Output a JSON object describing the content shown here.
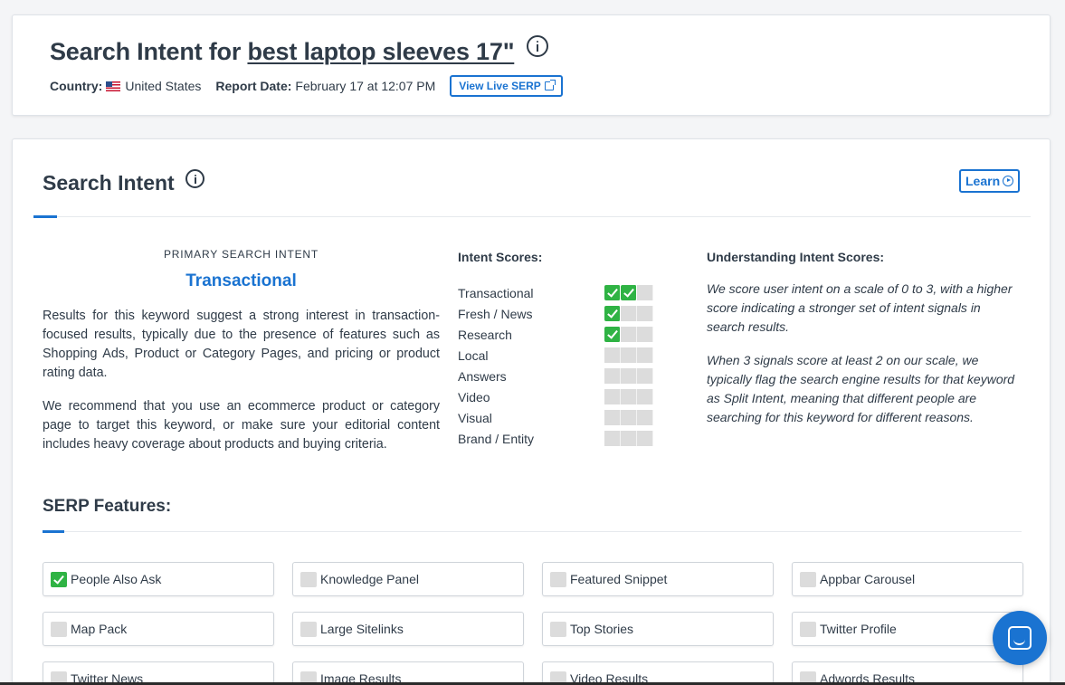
{
  "header": {
    "title_prefix": "Search Intent for",
    "keyword": "best laptop sleeves 17\"",
    "country_label": "Country:",
    "country_value": "United States",
    "report_date_label": "Report Date:",
    "report_date_value": "February 17 at 12:07 PM",
    "view_live_serp": "View Live SERP"
  },
  "intent_section": {
    "title": "Search Intent",
    "learn_label": "Learn",
    "primary_label": "PRIMARY SEARCH INTENT",
    "primary_value": "Transactional",
    "paragraph1": "Results for this keyword suggest a strong interest in transaction-focused results, typically due to the presence of features such as Shopping Ads, Product or Category Pages, and pricing or product rating data.",
    "paragraph2": "We recommend that you use an ecommerce product or category page to target this keyword, or make sure your editorial content includes heavy coverage about products and buying criteria.",
    "scores_title": "Intent Scores:",
    "scores": [
      {
        "name": "Transactional",
        "score": 2
      },
      {
        "name": "Fresh / News",
        "score": 1
      },
      {
        "name": "Research",
        "score": 1
      },
      {
        "name": "Local",
        "score": 0
      },
      {
        "name": "Answers",
        "score": 0
      },
      {
        "name": "Video",
        "score": 0
      },
      {
        "name": "Visual",
        "score": 0
      },
      {
        "name": "Brand / Entity",
        "score": 0
      }
    ],
    "understanding_title": "Understanding Intent Scores:",
    "understanding_p1": "We score user intent on a scale of 0 to 3, with a higher score indicating a stronger set of intent signals in search results.",
    "understanding_p2": "When 3 signals score at least 2 on our scale, we typically flag the search engine results for that keyword as Split Intent, meaning that different people are searching for this keyword for different reasons."
  },
  "serp_features": {
    "title": "SERP Features:",
    "items": [
      {
        "label": "People Also Ask",
        "checked": true
      },
      {
        "label": "Knowledge Panel",
        "checked": false
      },
      {
        "label": "Featured Snippet",
        "checked": false
      },
      {
        "label": "Appbar Carousel",
        "checked": false
      },
      {
        "label": "Map Pack",
        "checked": false
      },
      {
        "label": "Large Sitelinks",
        "checked": false
      },
      {
        "label": "Top Stories",
        "checked": false
      },
      {
        "label": "Twitter Profile",
        "checked": false
      },
      {
        "label": "Twitter News",
        "checked": false
      },
      {
        "label": "Image Results",
        "checked": false
      },
      {
        "label": "Video Results",
        "checked": false
      },
      {
        "label": "Adwords Results",
        "checked": false
      }
    ]
  },
  "colors": {
    "accent": "#1a73d1",
    "check_green": "#2fb344",
    "text": "#2f3b48"
  }
}
